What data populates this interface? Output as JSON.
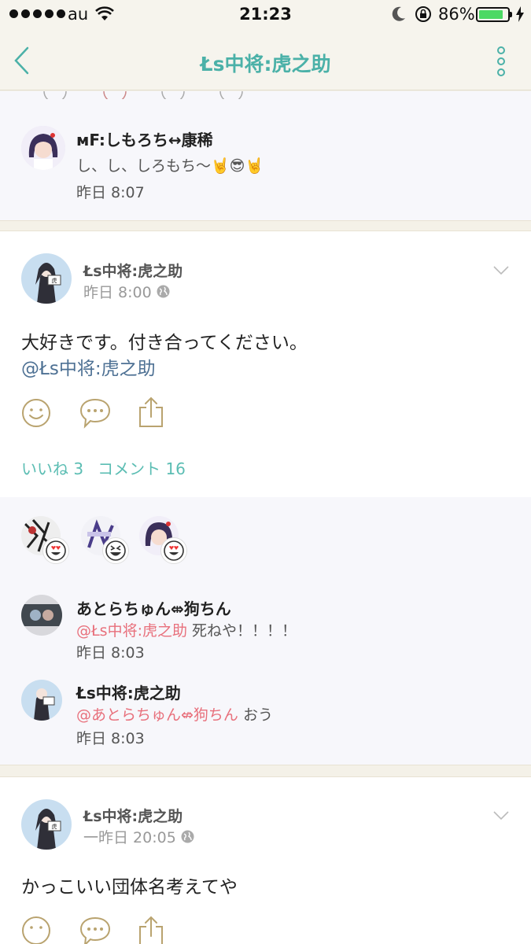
{
  "status": {
    "carrier": "au",
    "time": "21:23",
    "battery": "86%",
    "battery_level": 0.86
  },
  "nav": {
    "title": "Łs中将:虎之助",
    "back_icon": "chevron-left-icon",
    "more_icon": "vertical-dots-icon"
  },
  "top_comment": {
    "name": "ᴍF:しもろち↔康稀",
    "text": "し、し、しろもち〜🤘😎🤘",
    "time": "昨日 8:07"
  },
  "post1": {
    "author": "Łs中将:虎之助",
    "time": "昨日 8:00",
    "text": "大好きです。付き合ってください。",
    "mention": "@Łs中将:虎之助",
    "likes": "いいね 3",
    "comments": "コメント 16",
    "comments_list": [
      {
        "name": "あとらちゅん⇎狗ちん",
        "mention": "@Łs中将:虎之助",
        "text": " 死ねや！！！！",
        "time": "昨日 8:03"
      },
      {
        "name": "Łs中将:虎之助",
        "mention": "@あとらちゅん⇎狗ちん",
        "text": " おう",
        "time": "昨日 8:03"
      }
    ]
  },
  "post2": {
    "author": "Łs中将:虎之助",
    "time": "一昨日 20:05",
    "text": "かっこいい団体名考えてや"
  },
  "colors": {
    "accent": "#4bb1a8",
    "mention_pink": "#e8707c",
    "mention_blue": "#4e7194",
    "icon_tan": "#b9a36f"
  }
}
